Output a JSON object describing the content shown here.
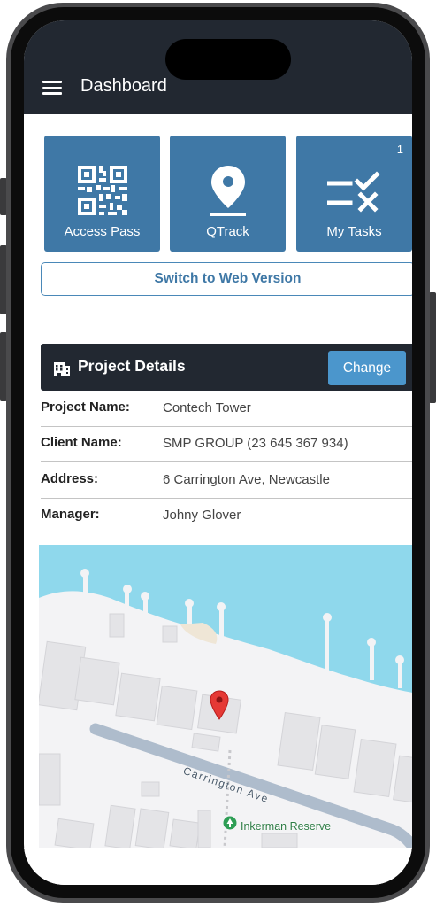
{
  "header": {
    "title": "Dashboard",
    "menu_icon": "hamburger-menu-icon"
  },
  "tiles": [
    {
      "label": "Access Pass",
      "icon": "qr-code-icon",
      "badge": ""
    },
    {
      "label": "QTrack",
      "icon": "location-pin-icon",
      "badge": ""
    },
    {
      "label": "My Tasks",
      "icon": "tasks-checklist-icon",
      "badge": "1"
    }
  ],
  "web_version_button": "Switch to Web Version",
  "project": {
    "heading": "Project Details",
    "heading_icon": "building-icon",
    "change_label": "Change",
    "rows": [
      {
        "label": "Project Name:",
        "value": "Contech Tower"
      },
      {
        "label": "Client Name:",
        "value": "SMP GROUP (23 645 367 934)"
      },
      {
        "label": "Address:",
        "value": "6 Carrington Ave, Newcastle"
      },
      {
        "label": "Manager:",
        "value": "Johny Glover"
      }
    ]
  },
  "map": {
    "street_label": "Carrington Ave",
    "poi_label": "Inkerman Reserve",
    "marker_icon": "map-marker-icon"
  },
  "colors": {
    "header_bg": "#222831",
    "tile_bg": "#3f78a6",
    "accent": "#4b96cc",
    "water": "#8fd8ec",
    "marker": "#e53935",
    "poi": "#2e9e55"
  }
}
